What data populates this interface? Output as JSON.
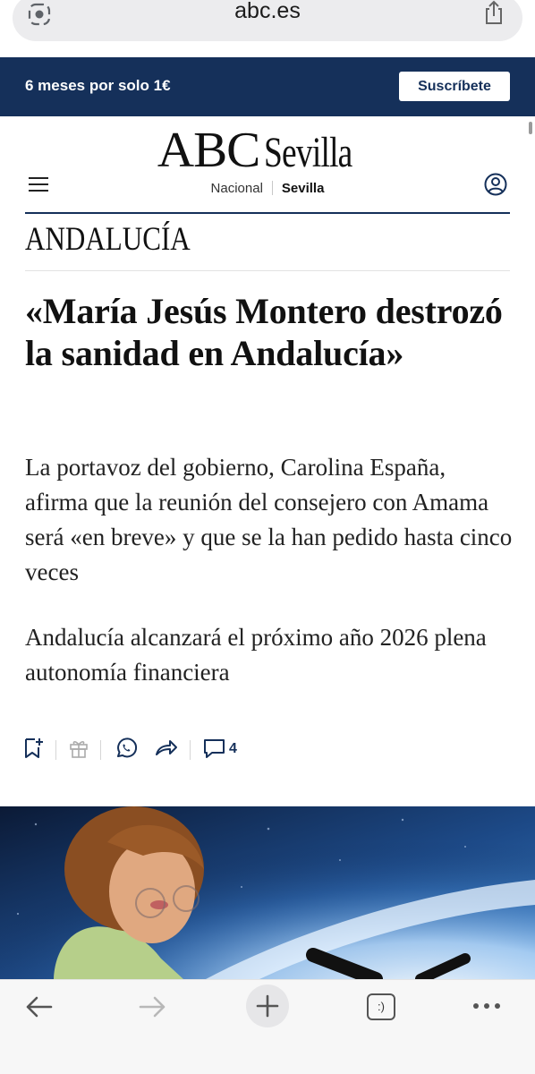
{
  "browser": {
    "url": "abc.es",
    "tab_count_label": ":)",
    "left_icon": "lens-icon",
    "share_icon": "share-icon"
  },
  "banner": {
    "text": "6 meses por solo 1€",
    "button_label": "Suscríbete",
    "background": "#15305a"
  },
  "masthead": {
    "logo_main": "ABC",
    "logo_city": "Sevilla",
    "editions": [
      "Nacional",
      "Sevilla"
    ],
    "active_edition": "Sevilla"
  },
  "article": {
    "section": "ANDALUCÍA",
    "headline": "«María Jesús Montero destrozó la sanidad en Andalucía»",
    "subheadline": "La portavoz del gobierno, Carolina España, afirma que la reunión del consejero con Amama será «en breve» y que se la han pedido hasta cinco veces",
    "related": "Andalucía alcanzará el próximo año 2026 plena autonomía financiera",
    "comment_count": "4"
  },
  "actions": [
    "bookmark-add-icon",
    "gift-icon",
    "whatsapp-icon",
    "share-arrow-icon",
    "comment-icon"
  ],
  "toolbar": [
    "back-icon",
    "forward-icon",
    "new-tab-icon",
    "tabs-icon",
    "more-icon"
  ]
}
